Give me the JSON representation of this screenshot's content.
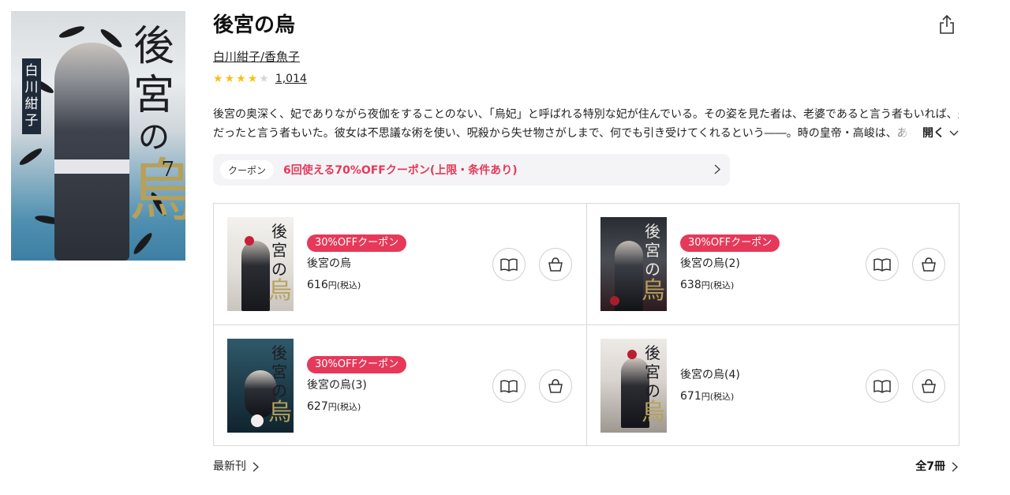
{
  "book": {
    "title": "後宮の烏",
    "authors": "白川紺子/香魚子",
    "rating": {
      "stars": 4,
      "max": 5,
      "count": "1,014"
    },
    "description_line1": "後宮の奥深く、妃でありながら夜伽をすることのない、「烏妃」と呼ばれる特別な妃が住んでいる。その姿を見た者は、老婆であると言う者もいれば、少女",
    "description_line2": "だったと言う者もいた。彼女は不思議な術を使い、呪殺から失せ物さがしまで、何でも引き受けてくれるという――。時の皇帝・高峻は、ある依頼",
    "open_label": "開く"
  },
  "cover": {
    "title_top": "後",
    "title_mid": "宮",
    "title_no": "の",
    "title_bird": "烏",
    "author": "白川紺子",
    "volume": "7"
  },
  "coupon": {
    "tag": "クーポン",
    "text": "6回使える70%OFFクーポン(上限・条件あり)"
  },
  "volumes": [
    {
      "name": "後宮の烏",
      "price": "616",
      "unit": "円(税込)",
      "badge": "30%OFFクーポン",
      "cover_title": "後宮の",
      "cover_bird": "烏"
    },
    {
      "name": "後宮の烏(2)",
      "price": "638",
      "unit": "円(税込)",
      "badge": "30%OFFクーポン",
      "cover_title": "後宮の",
      "cover_bird": "烏"
    },
    {
      "name": "後宮の烏(3)",
      "price": "627",
      "unit": "円(税込)",
      "badge": "30%OFFクーポン",
      "cover_title": "後宮の",
      "cover_bird": "烏"
    },
    {
      "name": "後宮の烏(4)",
      "price": "671",
      "unit": "円(税込)",
      "badge": "",
      "cover_title": "後宮の",
      "cover_bird": "烏"
    }
  ],
  "footer": {
    "latest": "最新刊",
    "all": "全7冊"
  },
  "colors": {
    "accent": "#e6395a",
    "star": "#f4c319",
    "border": "#d9d9d9"
  },
  "icons": {
    "share": "share-icon",
    "read": "book-open-icon",
    "cart": "shopping-basket-icon",
    "chevron": "chevron-right-icon"
  }
}
